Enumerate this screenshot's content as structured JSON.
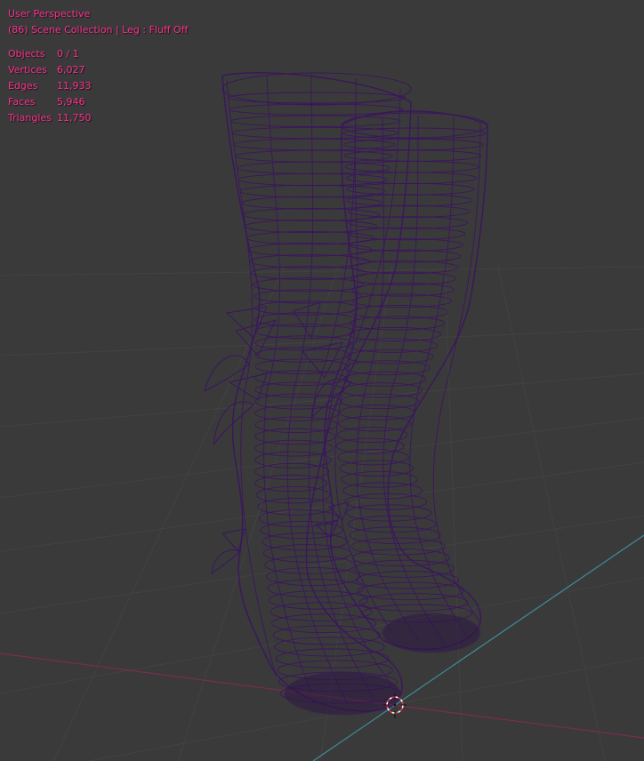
{
  "viewport": {
    "view_name": "User Perspective",
    "collection_info": "(86) Scene Collection | Leg : Fluff Off"
  },
  "stats": [
    {
      "label": "Objects",
      "value": "0 / 1"
    },
    {
      "label": "Vertices",
      "value": "6,027"
    },
    {
      "label": "Edges",
      "value": "11,933"
    },
    {
      "label": "Faces",
      "value": "5,946"
    },
    {
      "label": "Triangles",
      "value": "11,750"
    }
  ],
  "colors": {
    "background": "#3a3a3a",
    "overlay_text": "#ff2f8f",
    "wireframe": "#3b1560",
    "x_axis": "#8a2f55",
    "y_axis": "#3f8c9a",
    "grid": "#414141"
  },
  "icons": {
    "cursor": "3d-cursor-icon"
  }
}
